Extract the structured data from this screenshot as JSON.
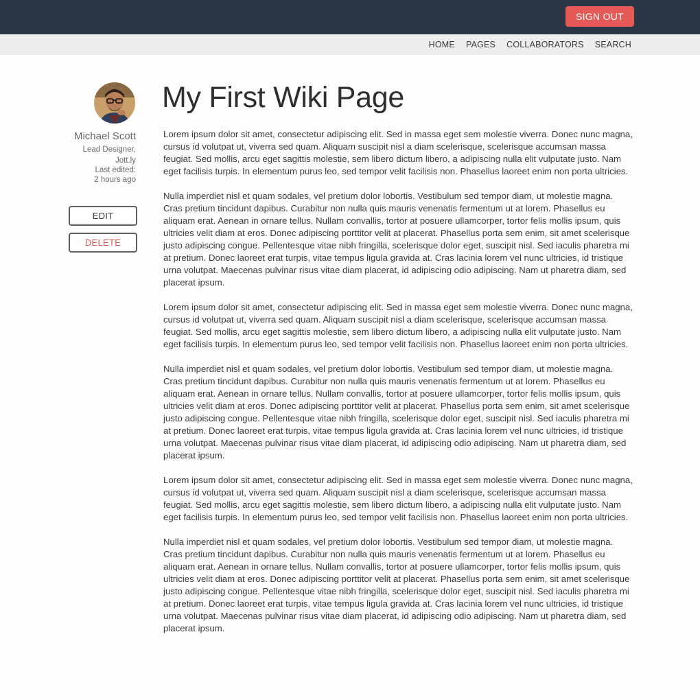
{
  "header": {
    "signout_label": "SIGN OUT"
  },
  "nav": {
    "items": [
      {
        "label": "HOME"
      },
      {
        "label": "PAGES"
      },
      {
        "label": "COLLABORATORS"
      },
      {
        "label": "SEARCH"
      }
    ]
  },
  "author": {
    "name": "Michael Scott",
    "role_line1": "Lead Designer,",
    "role_line2": "Jott.ly",
    "edited_label": "Last edited:",
    "edited_time": "2 hours ago"
  },
  "actions": {
    "edit_label": "EDIT",
    "delete_label": "DELETE"
  },
  "page": {
    "title": "My First Wiki Page",
    "paragraphs": [
      "Lorem ipsum dolor sit amet, consectetur adipiscing elit. Sed in massa eget sem molestie viverra. Donec nunc magna, cursus id volutpat ut, viverra sed quam. Aliquam suscipit nisl a diam scelerisque, scelerisque accumsan massa feugiat. Sed mollis, arcu eget sagittis molestie, sem libero dictum libero, a adipiscing nulla elit vulputate justo. Nam eget facilisis turpis. In elementum purus leo, sed tempor velit facilisis non. Phasellus laoreet enim non porta ultricies.",
      "Nulla imperdiet nisl et quam sodales, vel pretium dolor lobortis. Vestibulum sed tempor diam, ut molestie magna. Cras pretium tincidunt dapibus. Curabitur non nulla quis mauris venenatis fermentum ut at lorem. Phasellus eu aliquam erat. Aenean in ornare tellus. Nullam convallis, tortor at posuere ullamcorper, tortor felis mollis ipsum, quis ultricies velit diam at eros. Donec adipiscing porttitor velit at placerat. Phasellus porta sem enim, sit amet scelerisque justo adipiscing congue. Pellentesque vitae nibh fringilla, scelerisque dolor eget, suscipit nisl. Sed iaculis pharetra mi at pretium. Donec laoreet erat turpis, vitae tempus ligula gravida at. Cras lacinia lorem vel nunc ultricies, id tristique urna volutpat. Maecenas pulvinar risus vitae diam placerat, id adipiscing odio adipiscing. Nam ut pharetra diam, sed placerat ipsum.",
      "Lorem ipsum dolor sit amet, consectetur adipiscing elit. Sed in massa eget sem molestie viverra. Donec nunc magna, cursus id volutpat ut, viverra sed quam. Aliquam suscipit nisl a diam scelerisque, scelerisque accumsan massa feugiat. Sed mollis, arcu eget sagittis molestie, sem libero dictum libero, a adipiscing nulla elit vulputate justo. Nam eget facilisis turpis. In elementum purus leo, sed tempor velit facilisis non. Phasellus laoreet enim non porta ultricies.",
      "Nulla imperdiet nisl et quam sodales, vel pretium dolor lobortis. Vestibulum sed tempor diam, ut molestie magna. Cras pretium tincidunt dapibus. Curabitur non nulla quis mauris venenatis fermentum ut at lorem. Phasellus eu aliquam erat. Aenean in ornare tellus. Nullam convallis, tortor at posuere ullamcorper, tortor felis mollis ipsum, quis ultricies velit diam at eros. Donec adipiscing porttitor velit at placerat. Phasellus porta sem enim, sit amet scelerisque justo adipiscing congue. Pellentesque vitae nibh fringilla, scelerisque dolor eget, suscipit nisl. Sed iaculis pharetra mi at pretium. Donec laoreet erat turpis, vitae tempus ligula gravida at. Cras lacinia lorem vel nunc ultricies, id tristique urna volutpat. Maecenas pulvinar risus vitae diam placerat, id adipiscing odio adipiscing. Nam ut pharetra diam, sed placerat ipsum.",
      "Lorem ipsum dolor sit amet, consectetur adipiscing elit. Sed in massa eget sem molestie viverra. Donec nunc magna, cursus id volutpat ut, viverra sed quam. Aliquam suscipit nisl a diam scelerisque, scelerisque accumsan massa feugiat. Sed mollis, arcu eget sagittis molestie, sem libero dictum libero, a adipiscing nulla elit vulputate justo. Nam eget facilisis turpis. In elementum purus leo, sed tempor velit facilisis non. Phasellus laoreet enim non porta ultricies.",
      "Nulla imperdiet nisl et quam sodales, vel pretium dolor lobortis. Vestibulum sed tempor diam, ut molestie magna. Cras pretium tincidunt dapibus. Curabitur non nulla quis mauris venenatis fermentum ut at lorem. Phasellus eu aliquam erat. Aenean in ornare tellus. Nullam convallis, tortor at posuere ullamcorper, tortor felis mollis ipsum, quis ultricies velit diam at eros. Donec adipiscing porttitor velit at placerat. Phasellus porta sem enim, sit amet scelerisque justo adipiscing congue. Pellentesque vitae nibh fringilla, scelerisque dolor eget, suscipit nisl. Sed iaculis pharetra mi at pretium. Donec laoreet erat turpis, vitae tempus ligula gravida at. Cras lacinia lorem vel nunc ultricies, id tristique urna volutpat. Maecenas pulvinar risus vitae diam placerat, id adipiscing odio adipiscing. Nam ut pharetra diam, sed placerat ipsum."
    ]
  },
  "colors": {
    "topbar": "#2b3646",
    "navbar": "#ededed",
    "accent_red": "#e55a56",
    "delete_text": "#e0504b"
  }
}
